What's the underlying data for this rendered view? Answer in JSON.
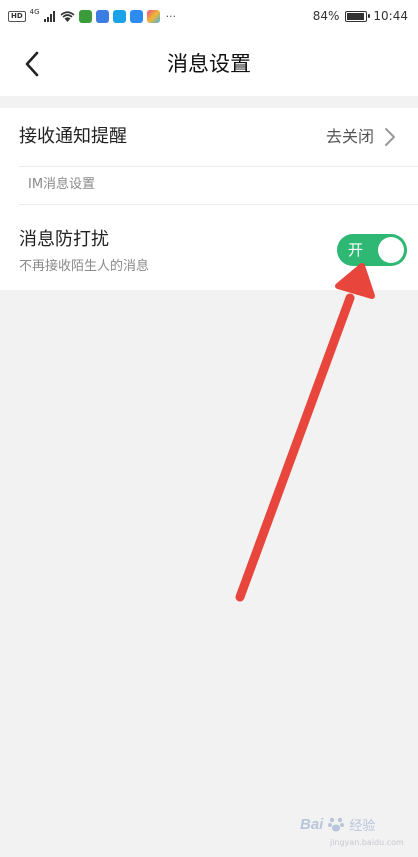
{
  "status_bar": {
    "network_badge": "HD",
    "network_type": "4G",
    "battery_percent": "84%",
    "battery_level": 0.84,
    "time": "10:44",
    "more": "···"
  },
  "nav": {
    "title": "消息设置",
    "back_icon": "chevron-left-icon"
  },
  "settings": {
    "notify": {
      "label": "接收通知提醒",
      "value": "去关闭",
      "icon": "chevron-right-icon"
    },
    "section_label": "IM消息设置",
    "dnd": {
      "label": "消息防打扰",
      "subtitle": "不再接收陌生人的消息",
      "toggle_label": "开",
      "toggle_on": true,
      "toggle_color": "#2eb873"
    }
  },
  "annotation": {
    "arrow_color": "#e8453c"
  },
  "watermark": {
    "logo": "Bai",
    "text": "经验",
    "url": "jingyan.baidu.com"
  }
}
